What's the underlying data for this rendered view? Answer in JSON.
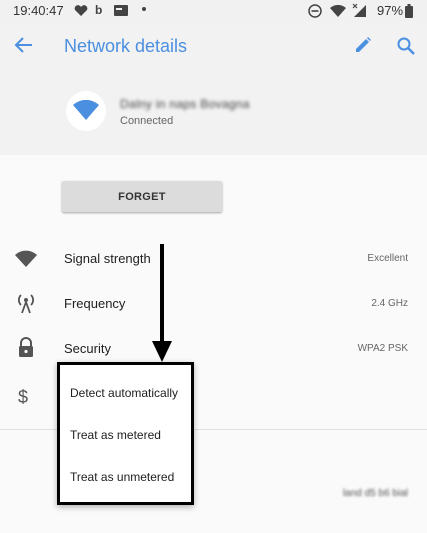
{
  "status_bar": {
    "time": "19:40:47",
    "battery_percent": "97%",
    "icons": [
      "heart-icon",
      "b-icon",
      "card-icon",
      "dot-icon",
      "dnd-icon",
      "wifi-icon",
      "signal-icon",
      "battery-icon"
    ]
  },
  "app_bar": {
    "title": "Network details",
    "icons": [
      "back-arrow-icon",
      "edit-pencil-icon",
      "search-icon"
    ]
  },
  "network": {
    "name": "Dalny in naps Bovagna",
    "status": "Connected"
  },
  "actions": {
    "forget_label": "FORGET"
  },
  "details": [
    {
      "label": "Signal strength",
      "value": "Excellent",
      "icon": "wifi-icon"
    },
    {
      "label": "Frequency",
      "value": "2.4 GHz",
      "icon": "antenna-icon"
    },
    {
      "label": "Security",
      "value": "WPA2 PSK",
      "icon": "lock-icon"
    },
    {
      "label": "",
      "value": "",
      "icon": "dollar-icon"
    }
  ],
  "advanced_value": "land d5 b6 bial",
  "metered_menu": {
    "options": [
      "Detect automatically",
      "Treat as metered",
      "Treat as unmetered"
    ]
  },
  "colors": {
    "accent": "#4a8fe0",
    "annotation": "#000000"
  }
}
